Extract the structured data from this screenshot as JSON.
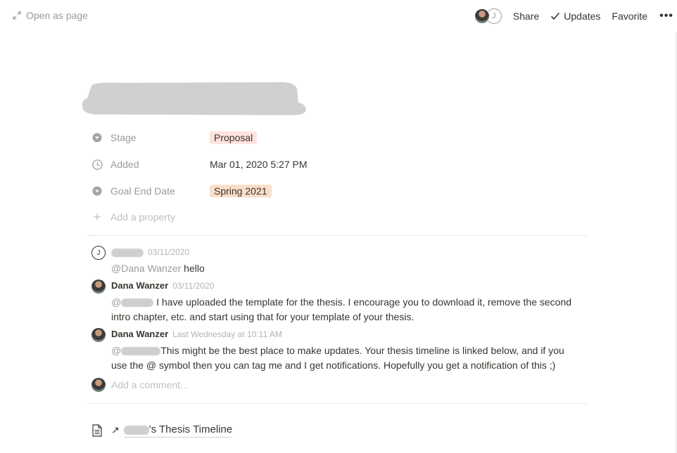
{
  "topbar": {
    "open_as_page": "Open as page",
    "avatar_letter": "J",
    "share": "Share",
    "updates": "Updates",
    "favorite": "Favorite",
    "more": "•••"
  },
  "properties": [
    {
      "name": "Stage",
      "value": "Proposal",
      "icon": "select-icon",
      "color": "#ffe2dd"
    },
    {
      "name": "Added",
      "value": "Mar 01, 2020 5:27 PM",
      "icon": "clock-icon"
    },
    {
      "name": "Goal End Date",
      "value": "Spring 2021",
      "icon": "select-icon",
      "color": "#fadec9"
    }
  ],
  "add_property": "Add a property",
  "comments": [
    {
      "author": "",
      "avatar": "J",
      "time": "03/11/2020",
      "mention": "@Dana Wanzer",
      "text": " hello"
    },
    {
      "author": "Dana Wanzer",
      "time": "03/11/2020",
      "mention": "@",
      "text": " I have uploaded the template for the thesis. I encourage you to download it, remove the second intro chapter, etc. and start using that for your template of your thesis."
    },
    {
      "author": "Dana Wanzer",
      "time": "Last Wednesday at 10:11 AM",
      "mention": "@",
      "text": "This might be the best place to make updates. Your thesis timeline is linked below, and if you use the @ symbol then you can tag me and I get notifications. Hopefully you get a notification of this ;)"
    }
  ],
  "add_comment": "Add a comment...",
  "linked_page": {
    "title_suffix": "'s Thesis Timeline",
    "arrow": "↗"
  }
}
